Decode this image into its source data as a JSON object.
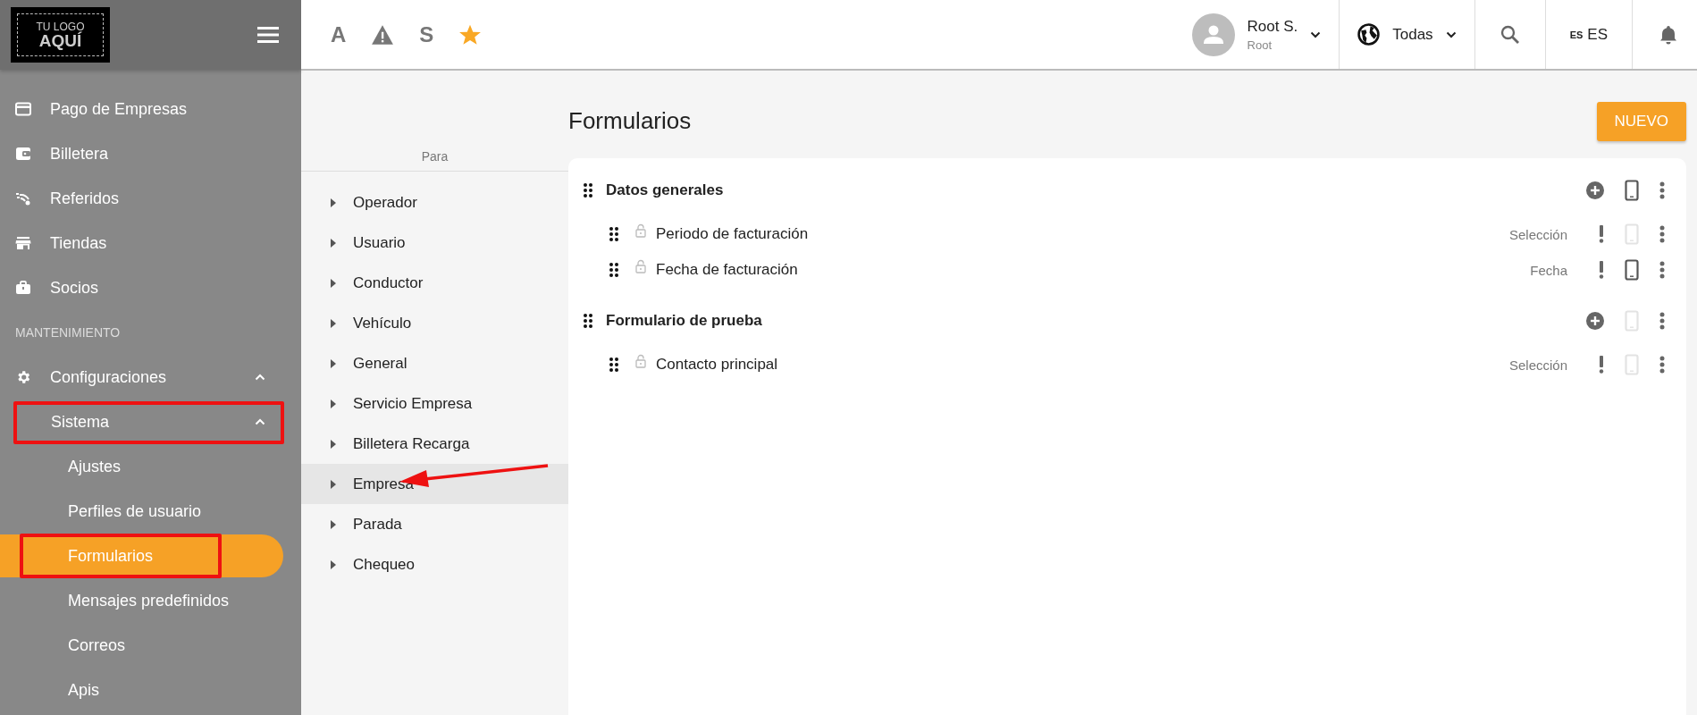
{
  "logo": {
    "line_1": "TU LOGO",
    "line_2": "AQUÍ"
  },
  "sidebar": {
    "items": [
      {
        "kind": "item",
        "label": "Pago de Empresas",
        "selected": false,
        "highlighted": false
      },
      {
        "kind": "item",
        "label": "Billetera",
        "selected": false,
        "highlighted": false
      },
      {
        "kind": "item",
        "label": "Referidos",
        "selected": false,
        "highlighted": false
      },
      {
        "kind": "item",
        "label": "Tiendas",
        "selected": false,
        "highlighted": false
      },
      {
        "kind": "item",
        "label": "Socios",
        "selected": false,
        "highlighted": false
      },
      {
        "kind": "section",
        "label": "MANTENIMIENTO"
      },
      {
        "kind": "group",
        "label": "Configuraciones",
        "expanded": true,
        "selected": false,
        "highlighted": false
      },
      {
        "kind": "subgroup",
        "label": "Sistema",
        "expanded": true,
        "selected": false,
        "highlighted": true
      },
      {
        "kind": "subitem",
        "label": "Ajustes",
        "selected": false,
        "highlighted": false
      },
      {
        "kind": "subitem",
        "label": "Perfiles de usuario",
        "selected": false,
        "highlighted": false
      },
      {
        "kind": "subitem",
        "label": "Formularios",
        "selected": true,
        "highlighted": true
      },
      {
        "kind": "subitem",
        "label": "Mensajes predefinidos",
        "selected": false,
        "highlighted": false
      },
      {
        "kind": "subitem",
        "label": "Correos",
        "selected": false,
        "highlighted": false
      },
      {
        "kind": "subitem",
        "label": "Apis",
        "selected": false,
        "highlighted": false
      }
    ]
  },
  "toolbar": [
    {
      "kind": "letter",
      "text": "A"
    },
    {
      "kind": "warning"
    },
    {
      "kind": "letter",
      "text": "S"
    },
    {
      "kind": "star"
    }
  ],
  "user": {
    "name": "Root S.",
    "role": "Root"
  },
  "region": {
    "label": "Todas"
  },
  "language": {
    "code": "ES",
    "label": "ES"
  },
  "para": {
    "header": "Para",
    "items": [
      {
        "label": "Operador",
        "selected": false,
        "pointed": false
      },
      {
        "label": "Usuario",
        "selected": false,
        "pointed": false
      },
      {
        "label": "Conductor",
        "selected": false,
        "pointed": false
      },
      {
        "label": "Vehículo",
        "selected": false,
        "pointed": false
      },
      {
        "label": "General",
        "selected": false,
        "pointed": false
      },
      {
        "label": "Servicio Empresa",
        "selected": false,
        "pointed": false
      },
      {
        "label": "Billetera Recarga",
        "selected": false,
        "pointed": false
      },
      {
        "label": "Empresa",
        "selected": true,
        "pointed": true
      },
      {
        "label": "Parada",
        "selected": false,
        "pointed": false
      },
      {
        "label": "Chequeo",
        "selected": false,
        "pointed": false
      }
    ]
  },
  "page": {
    "title": "Formularios",
    "new_button": "NUEVO"
  },
  "groups": [
    {
      "title": "Datos generales",
      "mobile": true,
      "fields": [
        {
          "label": "Periodo de facturación",
          "type": "Selección",
          "mobile": false
        },
        {
          "label": "Fecha de facturación",
          "type": "Fecha",
          "mobile": true
        }
      ]
    },
    {
      "title": "Formulario de prueba",
      "mobile": false,
      "fields": [
        {
          "label": "Contacto principal",
          "type": "Selección",
          "mobile": false
        }
      ]
    }
  ]
}
